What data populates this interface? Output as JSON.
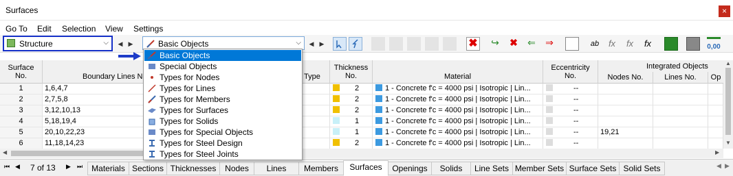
{
  "window": {
    "title": "Surfaces",
    "close": "×"
  },
  "menu": [
    "Go To",
    "Edit",
    "Selection",
    "View",
    "Settings"
  ],
  "structure_combo": {
    "label": "Structure"
  },
  "object_combo": {
    "label": "Basic Objects"
  },
  "toolbar_icons": [
    "select-icon",
    "select-icon",
    "table-icon",
    "table-icon",
    "table-icon",
    "table-icon",
    "table-icon",
    "delete-icon",
    "import-icon",
    "delete-icon",
    "arrow-left-icon",
    "arrow-right-icon",
    "window-icon",
    "ab-sum-icon",
    "fx-icon",
    "fx-x-icon",
    "fx-check-icon",
    "excel-icon",
    "print-icon",
    "decimal-icon"
  ],
  "columns": {
    "surface_no": "Surface\nNo.",
    "boundary": "Boundary Lines No.",
    "type": "Type",
    "thickness": "Thickness\nNo.",
    "material": "Material",
    "ecc": "Eccentricity\nNo.",
    "integrated": "Integrated Objects",
    "nodes": "Nodes No.",
    "lines": "Lines No.",
    "op": "Op"
  },
  "rows": [
    {
      "no": "1",
      "boundary": "1,6,4,7",
      "th_color": "#f0c000",
      "th": "2",
      "mat": "1 - Concrete f'c = 4000 psi | Isotropic | Lin...",
      "ecc": "--",
      "nodes": ""
    },
    {
      "no": "2",
      "boundary": "2,7,5,8",
      "th_color": "#f0c000",
      "th": "2",
      "mat": "1 - Concrete f'c = 4000 psi | Isotropic | Lin...",
      "ecc": "--",
      "nodes": ""
    },
    {
      "no": "3",
      "boundary": "3,12,10,13",
      "th_color": "#f0c000",
      "th": "2",
      "mat": "1 - Concrete f'c = 4000 psi | Isotropic | Lin...",
      "ecc": "--",
      "nodes": ""
    },
    {
      "no": "4",
      "boundary": "5,18,19,4",
      "th_color": "#c8f0f8",
      "th": "1",
      "mat": "1 - Concrete f'c = 4000 psi | Isotropic | Lin...",
      "ecc": "--",
      "nodes": ""
    },
    {
      "no": "5",
      "boundary": "20,10,22,23",
      "th_color": "#c8f0f8",
      "th": "1",
      "mat": "1 - Concrete f'c = 4000 psi | Isotropic | Lin...",
      "ecc": "--",
      "nodes": "19,21"
    },
    {
      "no": "6",
      "boundary": "11,18,14,23",
      "th_color": "#f0c000",
      "th": "2",
      "mat": "1 - Concrete f'c = 4000 psi | Isotropic | Lin...",
      "ecc": "--",
      "nodes": ""
    }
  ],
  "material_color": "#3c9ae0",
  "dropdown": [
    {
      "label": "Basic Objects",
      "icon": "basic-objects-icon",
      "sel": true
    },
    {
      "label": "Special Objects",
      "icon": "special-objects-icon"
    },
    {
      "label": "Types for Nodes",
      "icon": "nodes-icon"
    },
    {
      "label": "Types for Lines",
      "icon": "lines-icon"
    },
    {
      "label": "Types for Members",
      "icon": "members-icon"
    },
    {
      "label": "Types for Surfaces",
      "icon": "surfaces-icon"
    },
    {
      "label": "Types for Solids",
      "icon": "solids-icon"
    },
    {
      "label": "Types for Special Objects",
      "icon": "special-objects-icon"
    },
    {
      "label": "Types for Steel Design",
      "icon": "steel-design-icon"
    },
    {
      "label": "Types for Steel Joints",
      "icon": "steel-joints-icon"
    }
  ],
  "pager": {
    "label": "7 of 13"
  },
  "tabs": [
    "Materials",
    "Sections",
    "Thicknesses",
    "Nodes",
    "Lines",
    "Members",
    "Surfaces",
    "Openings",
    "Solids",
    "Line Sets",
    "Member Sets",
    "Surface Sets",
    "Solid Sets"
  ],
  "active_tab": "Surfaces"
}
